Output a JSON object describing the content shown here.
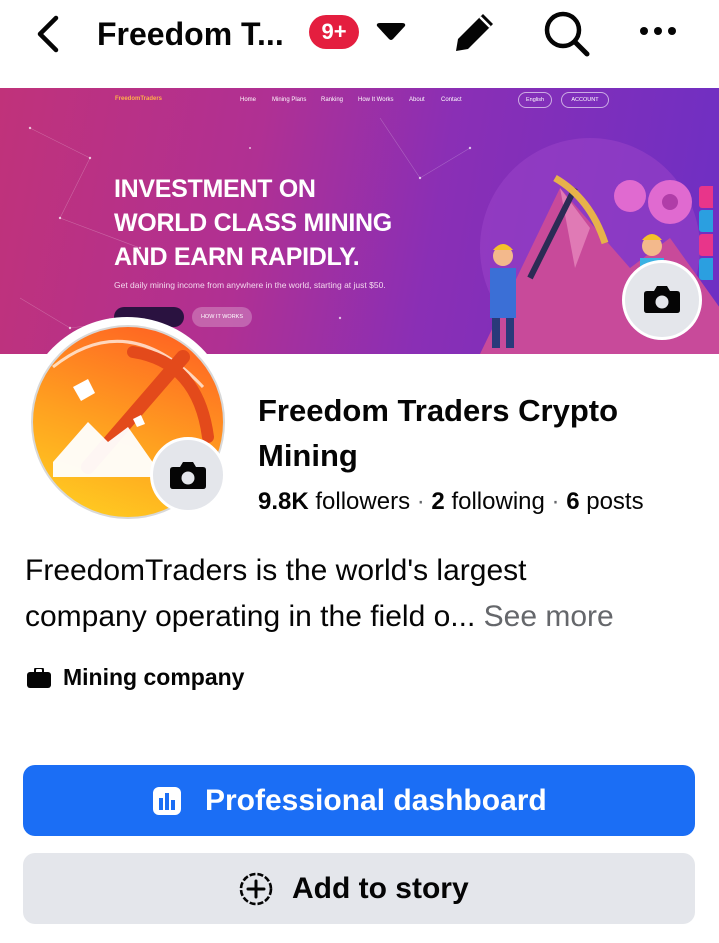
{
  "header": {
    "title": "Freedom T...",
    "notification_badge": "9+",
    "icons": [
      "back-arrow-icon",
      "caret-down-icon",
      "pencil-icon",
      "search-icon",
      "more-icon"
    ]
  },
  "cover": {
    "logo_text": "FreedomTraders",
    "nav": [
      "Home",
      "Mining Plans",
      "Ranking",
      "How It Works",
      "About",
      "Contact"
    ],
    "language": "English",
    "account": "ACCOUNT",
    "headline_1": "INVESTMENT ON",
    "headline_2": "WORLD CLASS MINING",
    "headline_3": "AND EARN RAPIDLY.",
    "subline": "Get daily mining income from anywhere in the world, starting at just $50.",
    "button_2": "HOW IT WORKS",
    "social_colors": [
      "#e8358a",
      "#2b9fe0",
      "#e8358a",
      "#2b9fe0"
    ]
  },
  "profile": {
    "name": "Freedom Traders Crypto Mining",
    "followers_count": "9.8K",
    "followers_label": "followers",
    "following_count": "2",
    "following_label": "following",
    "posts_count": "6",
    "posts_label": "posts",
    "separator": "·"
  },
  "bio": {
    "text_line1": "FreedomTraders is the world's largest",
    "text_line2": "company operating in the field o...",
    "see_more": "See more"
  },
  "category": {
    "icon": "briefcase-icon",
    "label": "Mining company"
  },
  "actions": {
    "professional_dashboard": "Professional dashboard",
    "add_to_story": "Add to story"
  },
  "colors": {
    "primary": "#1b6ef5",
    "badge": "#e41e3f",
    "secondary_bg": "#e4e6eb",
    "muted_text": "#65676b"
  }
}
